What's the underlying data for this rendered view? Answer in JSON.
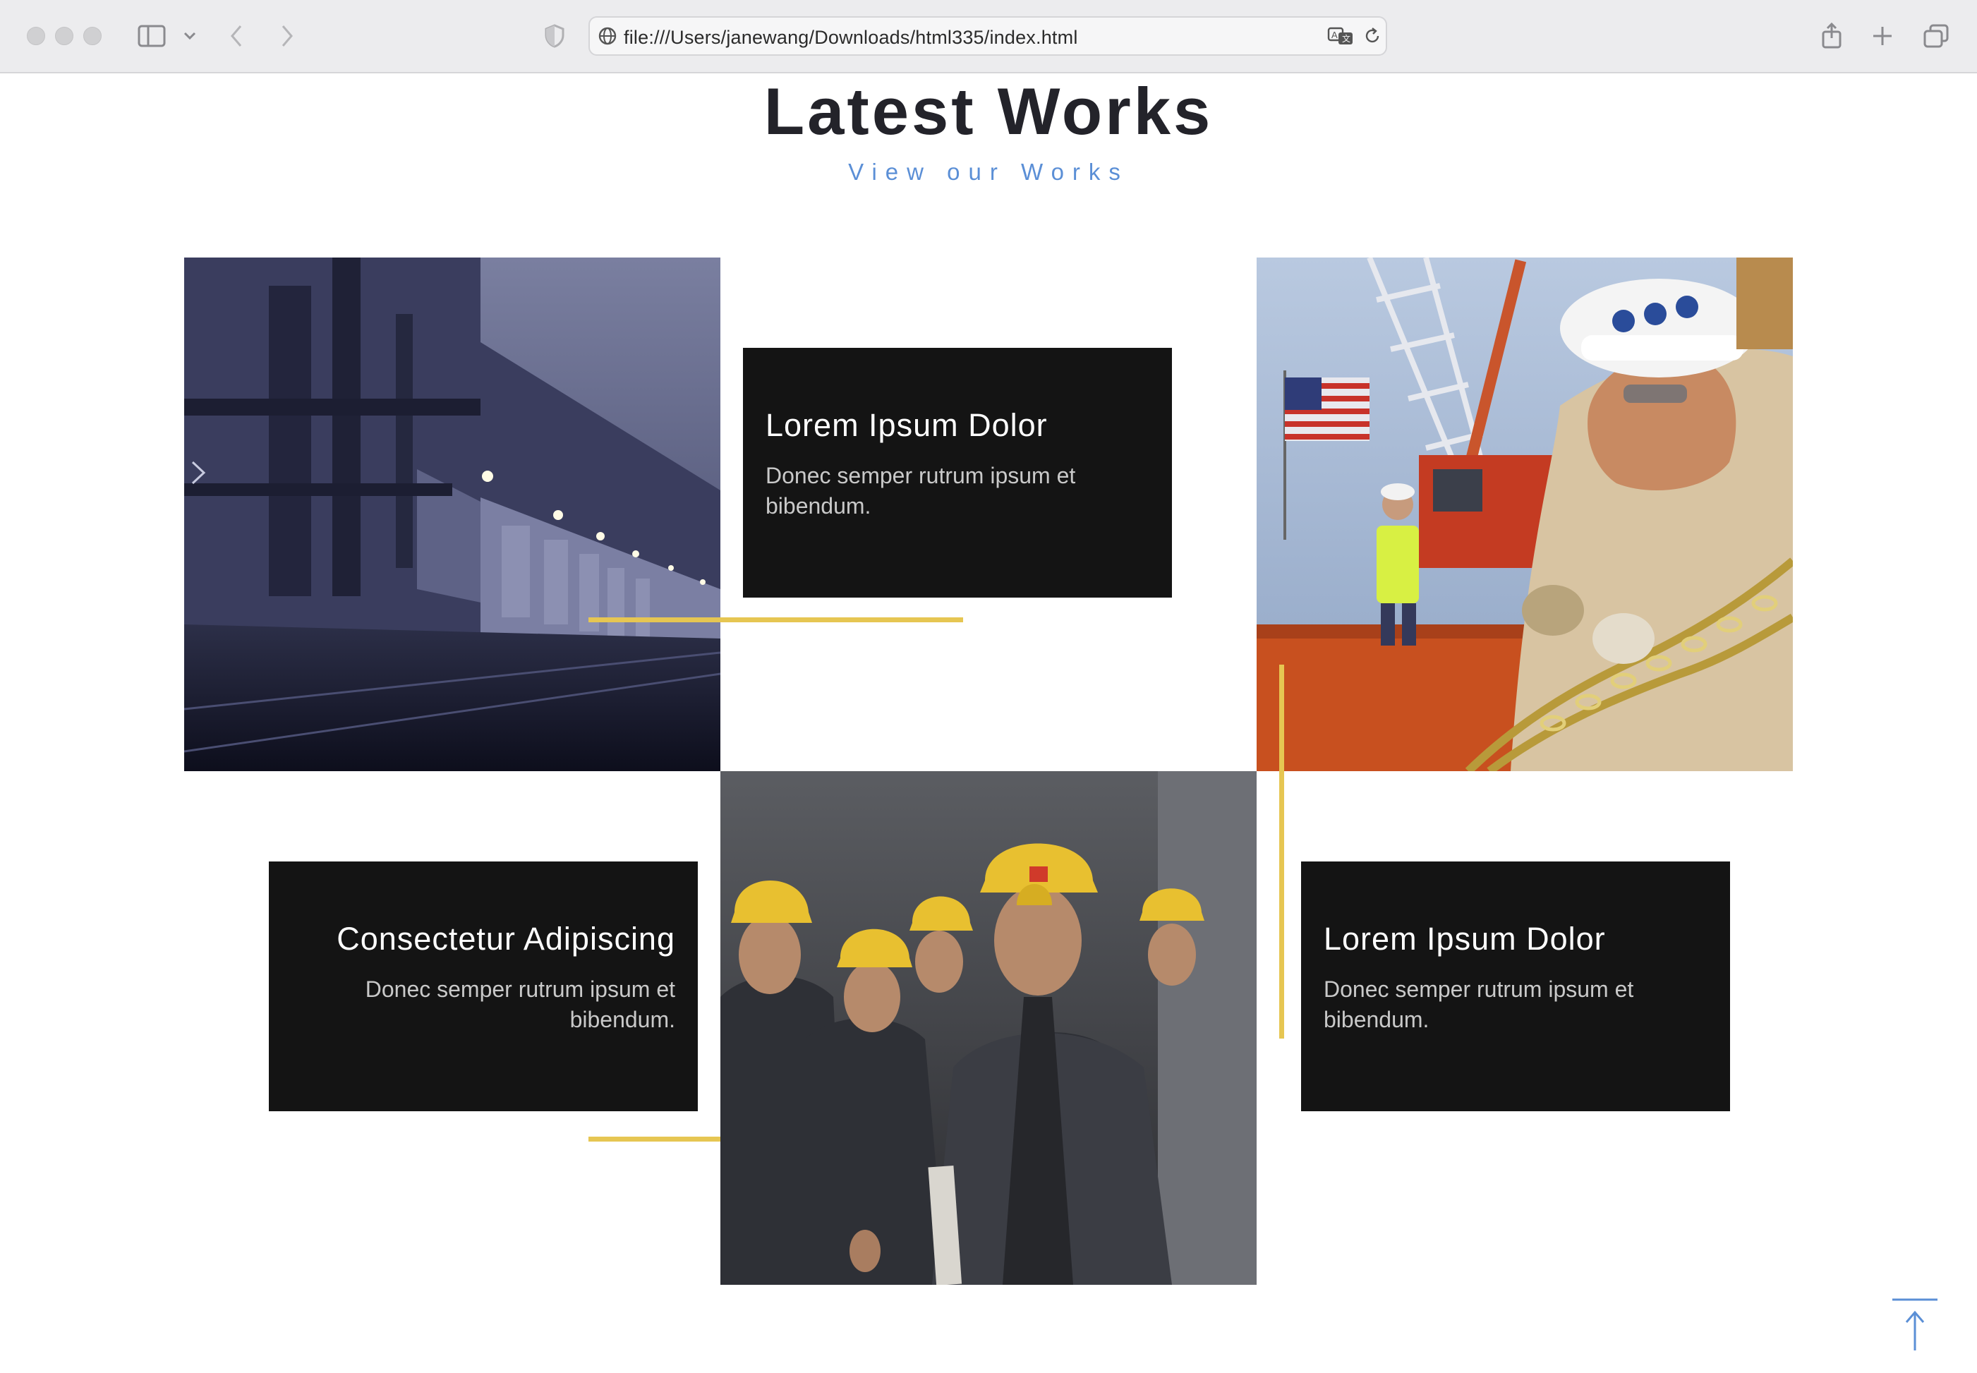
{
  "browser": {
    "url": "file:///Users/janewang/Downloads/html335/index.html",
    "icons": [
      "sidebar-icon",
      "chevron-down-icon",
      "back-icon",
      "forward-icon",
      "shield-icon",
      "globe-icon",
      "translate-icon",
      "reload-icon",
      "share-icon",
      "new-tab-icon",
      "tabs-overview-icon"
    ]
  },
  "section": {
    "title": "Latest Works",
    "subtitle": "View our Works"
  },
  "works": [
    {
      "title": "Lorem Ipsum Dolor",
      "text": "Donec semper rutrum ipsum et bibendum."
    },
    {
      "title": "Consectetur Adipiscing",
      "text": "Donec semper rutrum ipsum et bibendum."
    },
    {
      "title": "Lorem Ipsum Dolor",
      "text": "Donec semper rutrum ipsum et bibendum."
    }
  ],
  "photos": [
    {
      "name": "industrial-warehouse-night-photo"
    },
    {
      "name": "construction-worker-chains-photo"
    },
    {
      "name": "workers-yellow-hardhats-photo"
    }
  ],
  "colors": {
    "accent": "#e6c652",
    "card_bg": "#141414",
    "subtitle": "#5b8fd6",
    "title": "#23232a"
  },
  "back_to_top": {
    "icon": "arrow-up-icon"
  }
}
